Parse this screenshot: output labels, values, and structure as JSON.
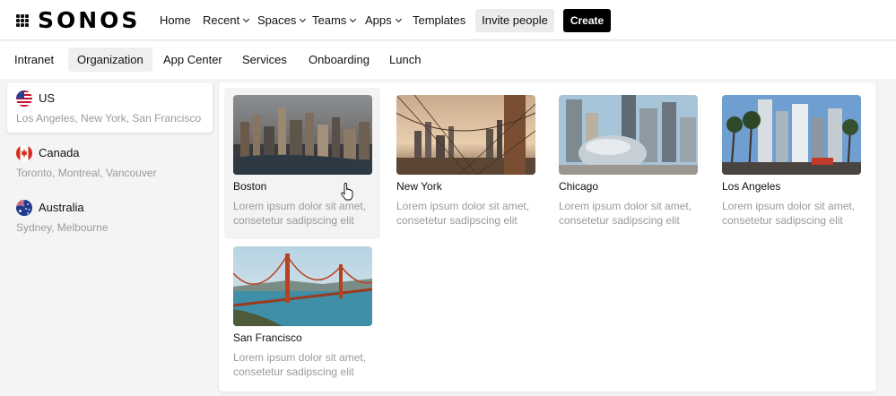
{
  "header": {
    "logo": "SONOS",
    "nav": [
      {
        "label": "Home",
        "dropdown": false
      },
      {
        "label": "Recent",
        "dropdown": true
      },
      {
        "label": "Spaces",
        "dropdown": true
      },
      {
        "label": "Teams",
        "dropdown": true
      },
      {
        "label": "Apps",
        "dropdown": true
      },
      {
        "label": "Templates",
        "dropdown": false
      }
    ],
    "invite_label": "Invite people",
    "create_label": "Create"
  },
  "tabs": [
    {
      "label": "Intranet",
      "active": false
    },
    {
      "label": "Organization",
      "active": true
    },
    {
      "label": "App Center",
      "active": false
    },
    {
      "label": "Services",
      "active": false
    },
    {
      "label": "Onboarding",
      "active": false
    },
    {
      "label": "Lunch",
      "active": false
    }
  ],
  "regions": [
    {
      "name": "US",
      "cities": "Los Angeles, New York, San Francisco",
      "flag": "us-flag-icon",
      "active": true
    },
    {
      "name": "Canada",
      "cities": "Toronto, Montreal, Vancouver",
      "flag": "canada-flag-icon",
      "active": false
    },
    {
      "name": "Australia",
      "cities": "Sydney, Melbourne",
      "flag": "australia-flag-icon",
      "active": false
    }
  ],
  "cities": [
    {
      "name": "Boston",
      "description": "Lorem ipsum dolor sit amet, consetetur sadipscing elit",
      "image": "boston-aerial-image"
    },
    {
      "name": "New York",
      "description": "Lorem ipsum dolor sit amet, consetetur sadipscing elit",
      "image": "new-york-bridge-image"
    },
    {
      "name": "Chicago",
      "description": "Lorem ipsum dolor sit amet, consetetur sadipscing elit",
      "image": "chicago-bean-image"
    },
    {
      "name": "Los Angeles",
      "description": "Lorem ipsum dolor sit amet, consetetur sadipscing elit",
      "image": "los-angeles-street-image"
    },
    {
      "name": "San Francisco",
      "description": "Lorem ipsum dolor sit amet, consetetur sadipscing elit",
      "image": "golden-gate-bridge-image"
    }
  ],
  "colors": {
    "accent": "#000000",
    "page_background": "#f4f4f5",
    "muted_text": "#9a9a9a",
    "active_tab": "#efefef"
  }
}
